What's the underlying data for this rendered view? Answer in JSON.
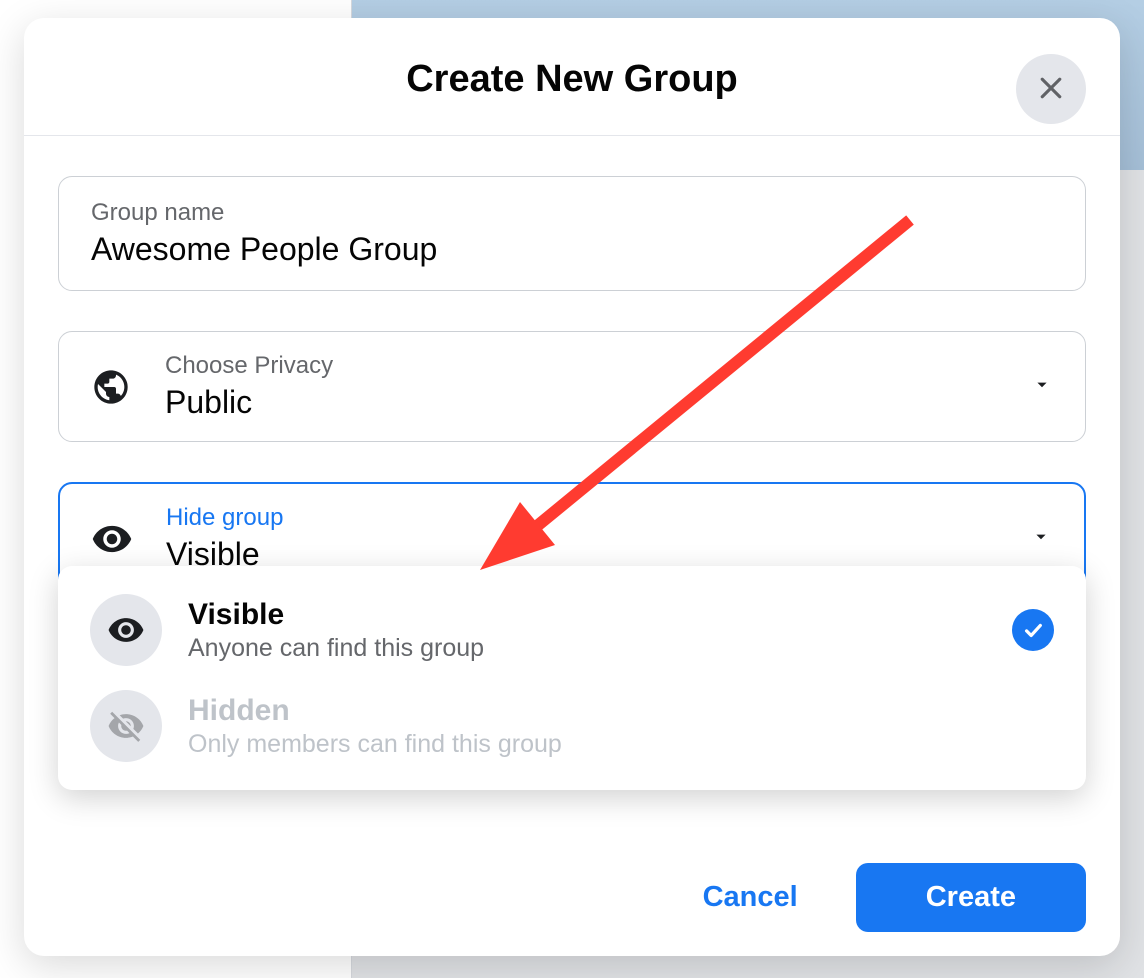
{
  "modal": {
    "title": "Create New Group",
    "group_name": {
      "label": "Group name",
      "value": "Awesome People Group"
    },
    "privacy": {
      "label": "Choose Privacy",
      "value": "Public"
    },
    "visibility": {
      "label": "Hide group",
      "value": "Visible"
    },
    "dropdown": {
      "options": [
        {
          "title": "Visible",
          "desc": "Anyone can find this group",
          "selected": true,
          "enabled": true
        },
        {
          "title": "Hidden",
          "desc": "Only members can find this group",
          "selected": false,
          "enabled": false
        }
      ]
    },
    "footer": {
      "cancel": "Cancel",
      "create": "Create"
    }
  }
}
